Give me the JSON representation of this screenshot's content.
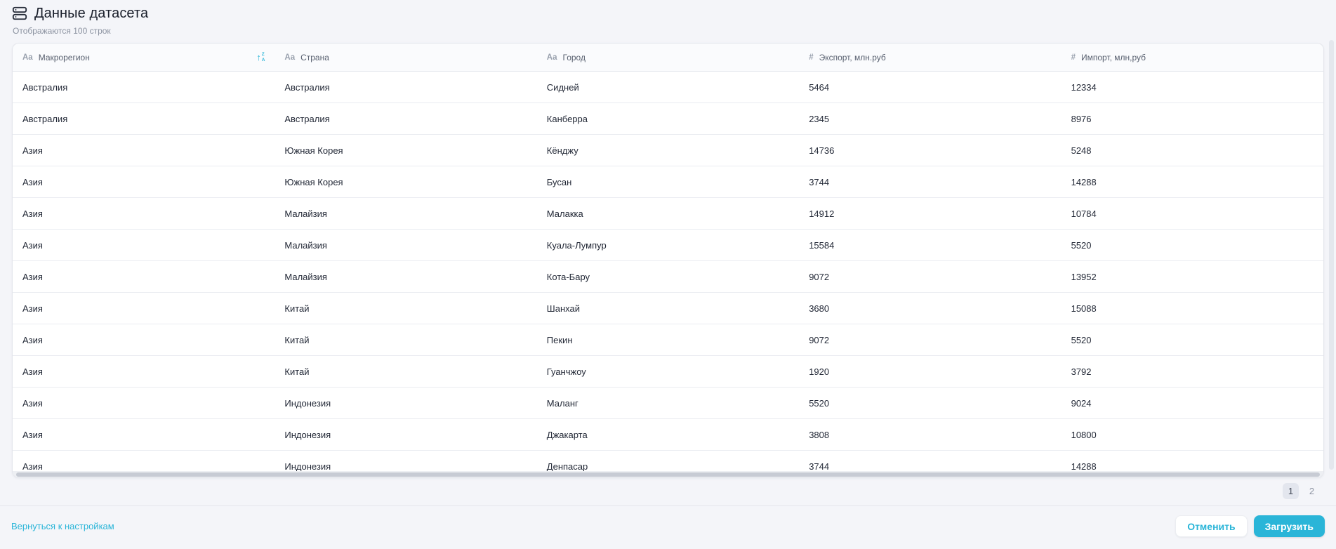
{
  "page": {
    "title": "Данные датасета",
    "subtitle": "Отображаются 100 строк"
  },
  "table": {
    "type_icons": {
      "text": "Aa",
      "number": "#"
    },
    "sort_icon": {
      "arrow": "↑",
      "top": "Z",
      "bottom": "A"
    },
    "columns": [
      {
        "key": "macroregion",
        "type": "text",
        "label": "Макрорегион",
        "sorted": true
      },
      {
        "key": "country",
        "type": "text",
        "label": "Страна"
      },
      {
        "key": "city",
        "type": "text",
        "label": "Город"
      },
      {
        "key": "export",
        "type": "number",
        "label": "Экспорт, млн.руб"
      },
      {
        "key": "import",
        "type": "number",
        "label": "Импорт, млн,руб"
      }
    ],
    "rows": [
      [
        "Австралия",
        "Австралия",
        "Сидней",
        "5464",
        "12334"
      ],
      [
        "Австралия",
        "Австралия",
        "Канберра",
        "2345",
        "8976"
      ],
      [
        "Азия",
        "Южная Корея",
        "Кёнджу",
        "14736",
        "5248"
      ],
      [
        "Азия",
        "Южная Корея",
        "Бусан",
        "3744",
        "14288"
      ],
      [
        "Азия",
        "Малайзия",
        "Малакка",
        "14912",
        "10784"
      ],
      [
        "Азия",
        "Малайзия",
        "Куала-Лумпур",
        "15584",
        "5520"
      ],
      [
        "Азия",
        "Малайзия",
        "Кота-Бару",
        "9072",
        "13952"
      ],
      [
        "Азия",
        "Китай",
        "Шанхай",
        "3680",
        "15088"
      ],
      [
        "Азия",
        "Китай",
        "Пекин",
        "9072",
        "5520"
      ],
      [
        "Азия",
        "Китай",
        "Гуанчжоу",
        "1920",
        "3792"
      ],
      [
        "Азия",
        "Индонезия",
        "Маланг",
        "5520",
        "9024"
      ],
      [
        "Азия",
        "Индонезия",
        "Джакарта",
        "3808",
        "10800"
      ],
      [
        "Азия",
        "Индонезия",
        "Денпасар",
        "3744",
        "14288"
      ]
    ]
  },
  "pagination": {
    "pages": [
      "1",
      "2"
    ],
    "active": "1"
  },
  "footer": {
    "back_link": "Вернуться к настройкам",
    "cancel_label": "Отменить",
    "submit_label": "Загрузить"
  },
  "colors": {
    "accent": "#2ab5d8",
    "page_bg": "#f4f5f9",
    "card_border": "#e4e6ec",
    "row_border": "#eaecf1"
  }
}
